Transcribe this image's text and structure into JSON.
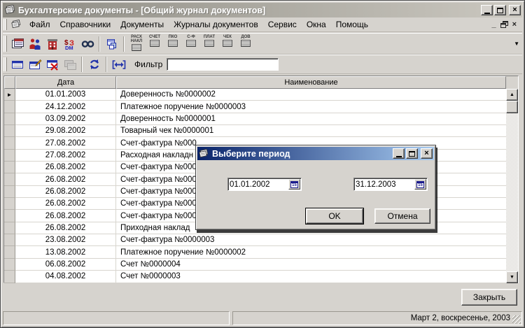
{
  "window": {
    "title": "Бухгалтерские документы - [Общий журнал документов]"
  },
  "menu": {
    "items": [
      "Файл",
      "Справочники",
      "Документы",
      "Журналы документов",
      "Сервис",
      "Окна",
      "Помощь"
    ]
  },
  "toolbar": {
    "icons_row1": [
      "journal-icon",
      "counterparties-icon",
      "organization-icon",
      "currency-icon",
      "search-icon",
      "cascade-windows-icon"
    ],
    "doc_buttons": [
      "РАСХ\nНАКЛ",
      "СЧЕТ",
      "ПКО",
      "С-Ф",
      "ПЛАТ",
      "ЧЕК",
      "ДОВ"
    ],
    "icons_row2": [
      "new-document-icon",
      "edit-document-icon",
      "delete-document-icon",
      "copy-document-icon",
      "refresh-icon",
      "interval-icon"
    ]
  },
  "filter": {
    "label": "Фильтр",
    "value": ""
  },
  "table": {
    "columns": [
      "Дата",
      "Наименование"
    ],
    "rows": [
      {
        "date": "01.01.2003",
        "name": "Доверенность №0000002",
        "current": true
      },
      {
        "date": "24.12.2002",
        "name": "Платежное поручение №0000003",
        "current": false
      },
      {
        "date": "03.09.2002",
        "name": "Доверенность №0000001",
        "current": false
      },
      {
        "date": "29.08.2002",
        "name": "Товарный чек №0000001",
        "current": false
      },
      {
        "date": "27.08.2002",
        "name": "Счет-фактура №000",
        "current": false
      },
      {
        "date": "27.08.2002",
        "name": "Расходная накладн",
        "current": false
      },
      {
        "date": "26.08.2002",
        "name": "Счет-фактура №000",
        "current": false
      },
      {
        "date": "26.08.2002",
        "name": "Счет-фактура №000",
        "current": false
      },
      {
        "date": "26.08.2002",
        "name": "Счет-фактура №000",
        "current": false
      },
      {
        "date": "26.08.2002",
        "name": "Счет-фактура №000",
        "current": false
      },
      {
        "date": "26.08.2002",
        "name": "Счет-фактура №000",
        "current": false
      },
      {
        "date": "26.08.2002",
        "name": "Приходная наклад",
        "current": false
      },
      {
        "date": "23.08.2002",
        "name": "Счет-фактура №0000003",
        "current": false
      },
      {
        "date": "13.08.2002",
        "name": "Платежное поручение №0000002",
        "current": false
      },
      {
        "date": "06.08.2002",
        "name": "Счет №0000004",
        "current": false
      },
      {
        "date": "04.08.2002",
        "name": "Счет №0000003",
        "current": false
      }
    ]
  },
  "dialog": {
    "title": "Выберите период",
    "period_from": "01.01.2002",
    "period_to": "31.12.2003",
    "ok_label": "OK",
    "cancel_label": "Отмена"
  },
  "footer": {
    "close_label": "Закрыть"
  },
  "statusbar": {
    "date_text": "Март 2, воскресенье, 2003"
  },
  "colors": {
    "face": "#d6d3ce",
    "active_title_start": "#0a246a",
    "active_title_end": "#a6caf0",
    "inactive_title_start": "#8d8b83",
    "inactive_title_end": "#cbc8c0"
  }
}
